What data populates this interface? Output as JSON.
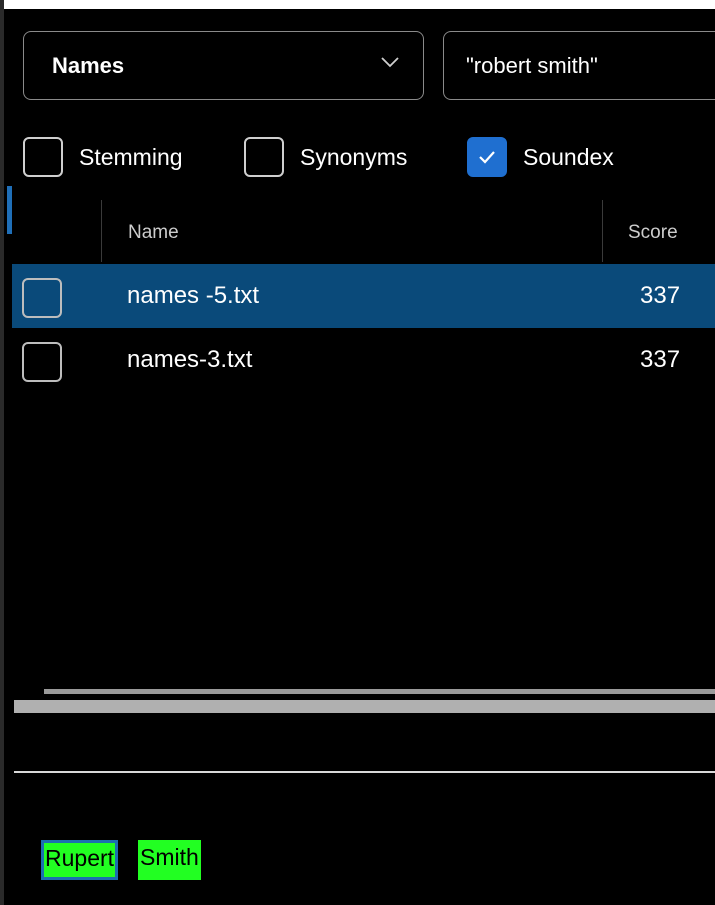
{
  "query": {
    "field_selected": "Names",
    "search_value": "\"robert smith\""
  },
  "options": [
    {
      "label": "Stemming",
      "checked": false
    },
    {
      "label": "Synonyms",
      "checked": false
    },
    {
      "label": "Soundex",
      "checked": true
    }
  ],
  "results": {
    "columns": {
      "name": "Name",
      "score": "Score"
    },
    "rows": [
      {
        "name": "names -5.txt",
        "score": "337",
        "selected": true
      },
      {
        "name": "names-3.txt",
        "score": "337",
        "selected": false
      }
    ]
  },
  "preview": {
    "hits": [
      "Rupert",
      "Smith"
    ]
  },
  "colors": {
    "accent": "#1f6fd0",
    "selected_row": "#0a4a7a",
    "highlight": "#22ff22"
  },
  "icons": {
    "dropdown": "chevron-down-icon",
    "check": "checkmark-icon"
  }
}
